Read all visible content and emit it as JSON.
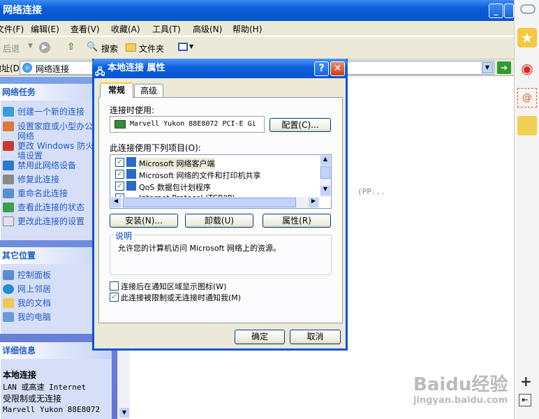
{
  "window": {
    "title": "网络连接",
    "min_label": "_",
    "close_label": "✕"
  },
  "menu": [
    "文件(F)",
    "编辑(E)",
    "查看(V)",
    "收藏(A)",
    "工具(T)",
    "高级(N)",
    "帮助(H)"
  ],
  "toolbar": {
    "back": "后退",
    "search": "搜索",
    "folders": "文件夹"
  },
  "address": {
    "label": "地址(D)",
    "value": "网络连接"
  },
  "network_tasks": {
    "title": "网络任务",
    "items": [
      "创建一个新的连接",
      "设置家庭或小型办公网络",
      "更改 Windows 防火墙设置",
      "禁用此网络设备",
      "修复此连接",
      "重命名此连接",
      "查看此连接的状态",
      "更改此连接的设置"
    ]
  },
  "other_places": {
    "title": "其它位置",
    "items": [
      "控制面板",
      "网上邻居",
      "我的文档",
      "我的电脑"
    ]
  },
  "details": {
    "title": "详细信息",
    "name": "本地连接",
    "type": "LAN 或高速 Internet",
    "status": "受限制或无连接",
    "adapter": "Marvell Yukon 88E8072"
  },
  "background_text": "(PP...",
  "dialog": {
    "title": "本地连接 属性",
    "help": "?",
    "close": "✕",
    "tabs": [
      "常规",
      "高级"
    ],
    "connect_using_label": "连接时使用:",
    "adapter_name": "Marvell Yukon 88E8072 PCI-E Gi",
    "configure_button": "配置(C)...",
    "items_label": "此连接使用下列项目(O):",
    "items": [
      {
        "label": "Microsoft 网络客户端",
        "checked": true
      },
      {
        "label": "Microsoft 网络的文件和打印机共享",
        "checked": true
      },
      {
        "label": "QoS 数据包计划程序",
        "checked": true
      },
      {
        "label": "Internet Protocol (TCP/IP)",
        "checked": true
      }
    ],
    "install_button": "安装(N)...",
    "uninstall_button": "卸载(U)",
    "properties_button": "属性(R)",
    "description_title": "说明",
    "description_text": "允许您的计算机访问 Microsoft 网络上的资源。",
    "show_icon_label": "连接后在通知区域显示图标(W)",
    "show_icon_checked": false,
    "notify_label": "此连接被限制或无连接时通知我(M)",
    "notify_checked": true,
    "ok_button": "确定",
    "cancel_button": "取消"
  },
  "right_sidebar": {
    "add": "+"
  },
  "watermark": {
    "brand": "Baidu经验",
    "url": "jingyan.baidu.com"
  },
  "colors": {
    "title_blue": "#0a5fd8",
    "task_link": "#215dc6",
    "xp_face": "#ece9d8"
  }
}
